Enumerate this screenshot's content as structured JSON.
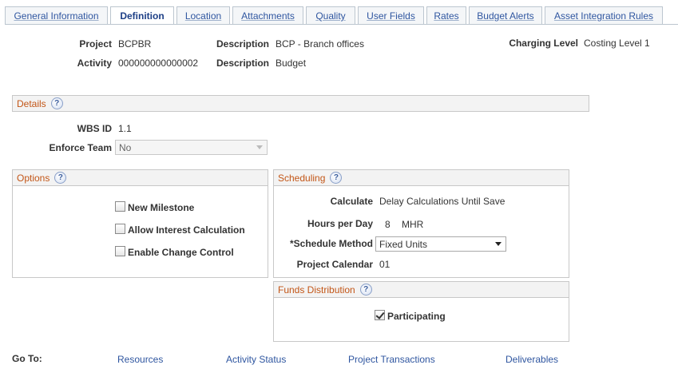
{
  "tabs": [
    {
      "label": "General Information",
      "active": false
    },
    {
      "label": "Definition",
      "active": true
    },
    {
      "label": "Location",
      "active": false
    },
    {
      "label": "Attachments",
      "active": false
    },
    {
      "label": "Quality",
      "active": false
    },
    {
      "label": "User Fields",
      "active": false
    },
    {
      "label": "Rates",
      "active": false
    },
    {
      "label": "Budget Alerts",
      "active": false
    },
    {
      "label": "Asset Integration Rules",
      "active": false
    }
  ],
  "header": {
    "project_label": "Project",
    "project_value": "BCPBR",
    "project_desc_label": "Description",
    "project_desc_value": "BCP - Branch offices",
    "charging_label": "Charging Level",
    "charging_value": "Costing Level 1",
    "activity_label": "Activity",
    "activity_value": "000000000000002",
    "activity_desc_label": "Description",
    "activity_desc_value": "Budget"
  },
  "details": {
    "title": "Details",
    "wbs_label": "WBS ID",
    "wbs_value": "1.1",
    "enforce_label": "Enforce Team",
    "enforce_value": "No"
  },
  "options": {
    "title": "Options",
    "new_milestone": {
      "label": "New Milestone",
      "checked": false
    },
    "allow_interest": {
      "label": "Allow Interest Calculation",
      "checked": false
    },
    "change_control": {
      "label": "Enable Change Control",
      "checked": false
    }
  },
  "scheduling": {
    "title": "Scheduling",
    "calculate_label": "Calculate",
    "calculate_value": "Delay Calculations Until Save",
    "hours_label": "Hours per Day",
    "hours_value": "8",
    "hours_unit": "MHR",
    "method_label": "*Schedule Method",
    "method_value": "Fixed Units",
    "calendar_label": "Project Calendar",
    "calendar_value": "01"
  },
  "funds": {
    "title": "Funds Distribution",
    "participating": {
      "label": "Participating",
      "checked": true
    }
  },
  "goto": {
    "label": "Go To:",
    "links": [
      "Resources",
      "Activity Status",
      "Project Transactions",
      "Deliverables"
    ]
  },
  "icons": {
    "help": "help-icon",
    "dropdown": "chevron-down-icon"
  },
  "colors": {
    "link": "#2f56a0",
    "group_title": "#c35617"
  }
}
